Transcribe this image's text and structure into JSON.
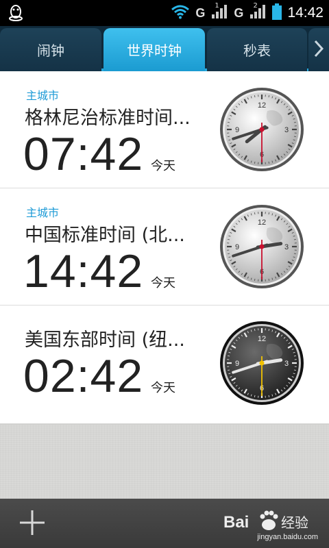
{
  "status_bar": {
    "network_1": "G",
    "network_2": "G",
    "sim_1": "1",
    "sim_2": "2",
    "time": "14:42",
    "icons": [
      "qq-penguin-icon",
      "wifi-icon",
      "signal-icon",
      "signal-icon",
      "battery-icon"
    ]
  },
  "tabs": [
    {
      "label": "闹钟",
      "active": false
    },
    {
      "label": "世界时钟",
      "active": true
    },
    {
      "label": "秒表",
      "active": false
    }
  ],
  "clocks": [
    {
      "home_label": "主城市",
      "city": "格林尼治标准时间...",
      "time": "07:42",
      "day": "今天",
      "hour": 7,
      "minute": 42,
      "second": 30,
      "face": "light"
    },
    {
      "home_label": "主城市",
      "city": "中国标准时间 (北...",
      "time": "14:42",
      "day": "今天",
      "hour": 14,
      "minute": 42,
      "second": 30,
      "face": "light"
    },
    {
      "home_label": "",
      "city": "美国东部时间 (纽...",
      "time": "02:42",
      "day": "今天",
      "hour": 2,
      "minute": 42,
      "second": 30,
      "face": "dark"
    }
  ],
  "clock_numerals": [
    "12",
    "3",
    "6",
    "9"
  ],
  "bottom_bar": {
    "add_icon": "plus-icon"
  },
  "watermark": {
    "brand": "Bai",
    "mark": "经验",
    "url": "jingyan.baidu.com"
  },
  "colors": {
    "accent": "#28a9dd",
    "tab_bg": "#0f2a3b",
    "second_hand_light": "#c8102e",
    "second_hand_dark": "#f2c200"
  }
}
